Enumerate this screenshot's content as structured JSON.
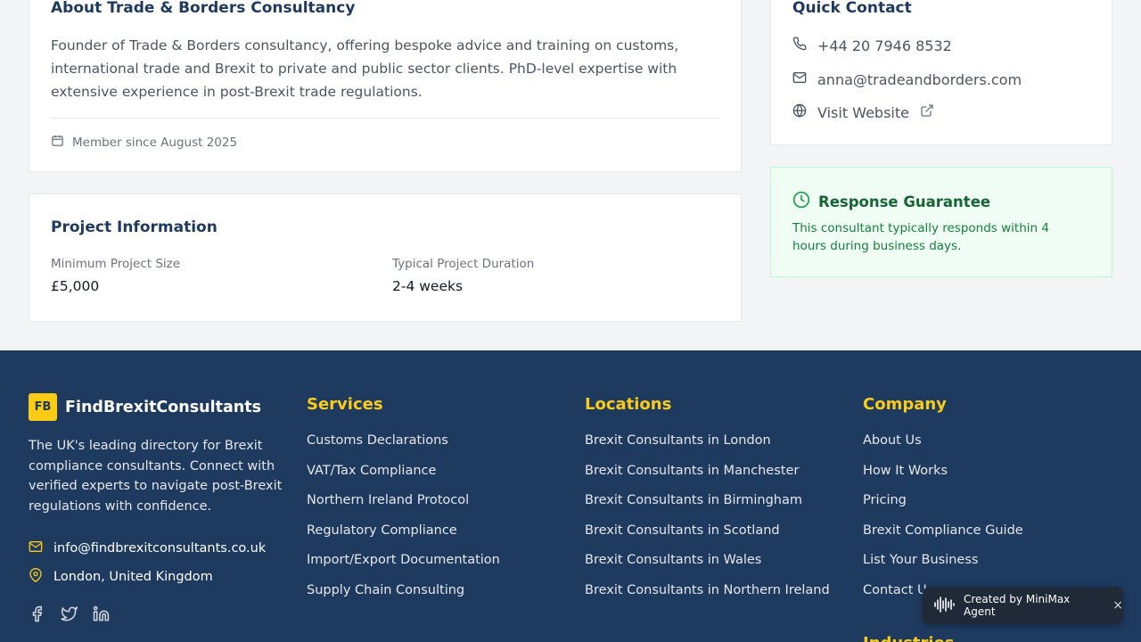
{
  "about": {
    "title": "About Trade & Borders Consultancy",
    "description": "Founder of Trade & Borders consultancy, offering bespoke advice and training on customs, international trade and Brexit to private and public sector clients. PhD-level expertise with extensive experience in post-Brexit trade regulations.",
    "member_since": "Member since August 2025"
  },
  "project": {
    "title": "Project Information",
    "min_size_label": "Minimum Project Size",
    "min_size_value": "£5,000",
    "duration_label": "Typical Project Duration",
    "duration_value": "2-4 weeks"
  },
  "quick_contact": {
    "title": "Quick Contact",
    "phone": "+44 20 7946 8532",
    "email": "anna@tradeandborders.com",
    "website": "Visit Website"
  },
  "guarantee": {
    "title": "Response Guarantee",
    "text": "This consultant typically responds within 4 hours during business days."
  },
  "footer": {
    "logo_badge": "FB",
    "brand": "FindBrexitConsultants",
    "description": "The UK's leading directory for Brexit compliance consultants. Connect with verified experts to navigate post-Brexit regulations with confidence.",
    "email": "info@findbrexitconsultants.co.uk",
    "location": "London, United Kingdom",
    "services": {
      "title": "Services",
      "links": [
        "Customs Declarations",
        "VAT/Tax Compliance",
        "Northern Ireland Protocol",
        "Regulatory Compliance",
        "Import/Export Documentation",
        "Supply Chain Consulting"
      ]
    },
    "locations": {
      "title": "Locations",
      "links": [
        "Brexit Consultants in London",
        "Brexit Consultants in Manchester",
        "Brexit Consultants in Birmingham",
        "Brexit Consultants in Scotland",
        "Brexit Consultants in Wales",
        "Brexit Consultants in Northern Ireland"
      ]
    },
    "company": {
      "title": "Company",
      "links": [
        "About Us",
        "How It Works",
        "Pricing",
        "Brexit Compliance Guide",
        "List Your Business",
        "Contact Us"
      ]
    },
    "next_heading": "Industries"
  },
  "badge": {
    "text": "Created by MiniMax Agent",
    "close": "×"
  },
  "colors": {
    "navy": "#1e3a5f",
    "accent": "#facc15",
    "green": "#166534"
  },
  "icons": [
    "calendar-icon",
    "phone-icon",
    "mail-icon",
    "globe-icon",
    "external-link-icon",
    "clock-icon",
    "map-pin-icon",
    "facebook-icon",
    "twitter-icon",
    "linkedin-icon",
    "waveform-icon"
  ]
}
